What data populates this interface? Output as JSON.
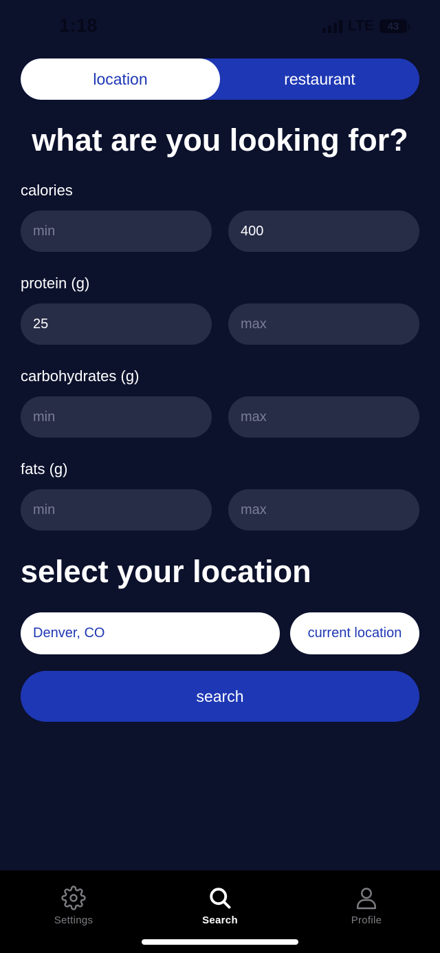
{
  "status_bar": {
    "time": "1:18",
    "network": "LTE",
    "battery": "43"
  },
  "mode_toggle": {
    "options": [
      "location",
      "restaurant"
    ],
    "selected": "location"
  },
  "heading": "what are you looking for?",
  "fields": [
    {
      "label": "calories",
      "min_value": "",
      "min_placeholder": "min",
      "max_value": "400",
      "max_placeholder": "max"
    },
    {
      "label": "protein (g)",
      "min_value": "25",
      "min_placeholder": "min",
      "max_value": "",
      "max_placeholder": "max"
    },
    {
      "label": "carbohydrates (g)",
      "min_value": "",
      "min_placeholder": "min",
      "max_value": "",
      "max_placeholder": "max"
    },
    {
      "label": "fats (g)",
      "min_value": "",
      "min_placeholder": "min",
      "max_value": "",
      "max_placeholder": "max"
    }
  ],
  "location_section": {
    "heading": "select your location",
    "location_value": "Denver, CO",
    "current_location_label": "current location"
  },
  "search_button_label": "search",
  "tab_bar": {
    "items": [
      {
        "label": "Settings",
        "icon": "gear-icon"
      },
      {
        "label": "Search",
        "icon": "search-icon"
      },
      {
        "label": "Profile",
        "icon": "person-icon"
      }
    ],
    "active": "Search"
  },
  "colors": {
    "background": "#0c112c",
    "accent": "#1e37b4",
    "input_bg": "#272c47",
    "tab_bar_bg": "#000000"
  }
}
